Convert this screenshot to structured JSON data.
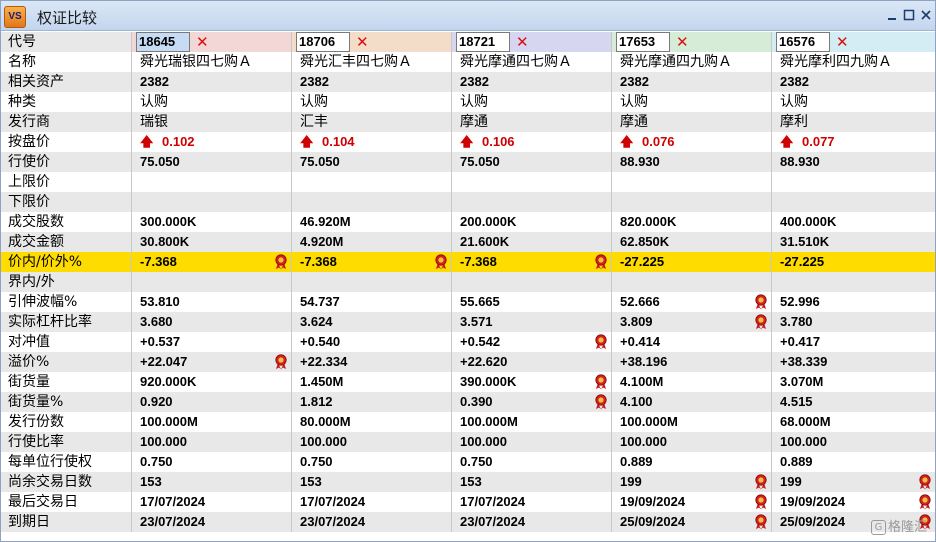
{
  "window": {
    "title": "权证比较",
    "icon_text": "VS"
  },
  "header": {
    "label": "代号",
    "codes": [
      "18645",
      "18706",
      "18721",
      "17653",
      "16576"
    ],
    "colors": [
      "#f3d6d6",
      "#f3dcc8",
      "#d6d6f0",
      "#d6ecd6",
      "#d4ecf3"
    ]
  },
  "rows": [
    {
      "label": "名称",
      "kind": "cn",
      "values": [
        "舜光瑞银四七购Ａ",
        "舜光汇丰四七购Ａ",
        "舜光摩通四七购Ａ",
        "舜光摩通四九购Ａ",
        "舜光摩利四九购Ａ"
      ]
    },
    {
      "label": "相关资产",
      "kind": "val",
      "values": [
        "2382",
        "2382",
        "2382",
        "2382",
        "2382"
      ]
    },
    {
      "label": "种类",
      "kind": "cn",
      "values": [
        "认购",
        "认购",
        "认购",
        "认购",
        "认购"
      ]
    },
    {
      "label": "发行商",
      "kind": "cn",
      "values": [
        "瑞银",
        "汇丰",
        "摩通",
        "摩通",
        "摩利"
      ]
    },
    {
      "label": "按盘价",
      "kind": "price",
      "values": [
        "0.102",
        "0.104",
        "0.106",
        "0.076",
        "0.077"
      ]
    },
    {
      "label": "行使价",
      "kind": "val",
      "values": [
        "75.050",
        "75.050",
        "75.050",
        "88.930",
        "88.930"
      ]
    },
    {
      "label": "上限价",
      "kind": "val",
      "values": [
        "",
        "",
        "",
        "",
        ""
      ]
    },
    {
      "label": "下限价",
      "kind": "val",
      "values": [
        "",
        "",
        "",
        "",
        ""
      ]
    },
    {
      "label": "成交股数",
      "kind": "val",
      "values": [
        "300.000K",
        "46.920M",
        "200.000K",
        "820.000K",
        "400.000K"
      ]
    },
    {
      "label": "成交金额",
      "kind": "val",
      "values": [
        "30.800K",
        "4.920M",
        "21.600K",
        "62.850K",
        "31.510K"
      ]
    },
    {
      "label": "价内/价外%",
      "kind": "val",
      "highlight": true,
      "values": [
        "-7.368",
        "-7.368",
        "-7.368",
        "-27.225",
        "-27.225"
      ],
      "medals": [
        true,
        true,
        true,
        false,
        false
      ]
    },
    {
      "label": "界内/外",
      "kind": "val",
      "values": [
        "",
        "",
        "",
        "",
        ""
      ]
    },
    {
      "label": "引伸波幅%",
      "kind": "val",
      "values": [
        "53.810",
        "54.737",
        "55.665",
        "52.666",
        "52.996"
      ],
      "medals": [
        false,
        false,
        false,
        true,
        false
      ]
    },
    {
      "label": "实际杠杆比率",
      "kind": "val",
      "values": [
        "3.680",
        "3.624",
        "3.571",
        "3.809",
        "3.780"
      ],
      "medals": [
        false,
        false,
        false,
        true,
        false
      ]
    },
    {
      "label": "对冲值",
      "kind": "val",
      "values": [
        "+0.537",
        "+0.540",
        "+0.542",
        "+0.414",
        "+0.417"
      ],
      "medals": [
        false,
        false,
        true,
        false,
        false
      ]
    },
    {
      "label": "溢价%",
      "kind": "val",
      "values": [
        "+22.047",
        "+22.334",
        "+22.620",
        "+38.196",
        "+38.339"
      ],
      "medals": [
        true,
        false,
        false,
        false,
        false
      ]
    },
    {
      "label": "街货量",
      "kind": "val",
      "values": [
        "920.000K",
        "1.450M",
        "390.000K",
        "4.100M",
        "3.070M"
      ],
      "medals": [
        false,
        false,
        true,
        false,
        false
      ]
    },
    {
      "label": "街货量%",
      "kind": "val",
      "values": [
        "0.920",
        "1.812",
        "0.390",
        "4.100",
        "4.515"
      ],
      "medals": [
        false,
        false,
        true,
        false,
        false
      ]
    },
    {
      "label": "发行份数",
      "kind": "val",
      "values": [
        "100.000M",
        "80.000M",
        "100.000M",
        "100.000M",
        "68.000M"
      ]
    },
    {
      "label": "行使比率",
      "kind": "val",
      "values": [
        "100.000",
        "100.000",
        "100.000",
        "100.000",
        "100.000"
      ]
    },
    {
      "label": "每单位行使权",
      "kind": "val",
      "values": [
        "0.750",
        "0.750",
        "0.750",
        "0.889",
        "0.889"
      ]
    },
    {
      "label": "尚余交易日数",
      "kind": "val",
      "values": [
        "153",
        "153",
        "153",
        "199",
        "199"
      ],
      "medals": [
        false,
        false,
        false,
        true,
        true
      ]
    },
    {
      "label": "最后交易日",
      "kind": "val",
      "values": [
        "17/07/2024",
        "17/07/2024",
        "17/07/2024",
        "19/09/2024",
        "19/09/2024"
      ],
      "medals": [
        false,
        false,
        false,
        true,
        true
      ]
    },
    {
      "label": "到期日",
      "kind": "val",
      "values": [
        "23/07/2024",
        "23/07/2024",
        "23/07/2024",
        "25/09/2024",
        "25/09/2024"
      ],
      "medals": [
        false,
        false,
        false,
        true,
        true
      ]
    }
  ],
  "watermark": {
    "text": "格隆汇",
    "icon": "G"
  }
}
